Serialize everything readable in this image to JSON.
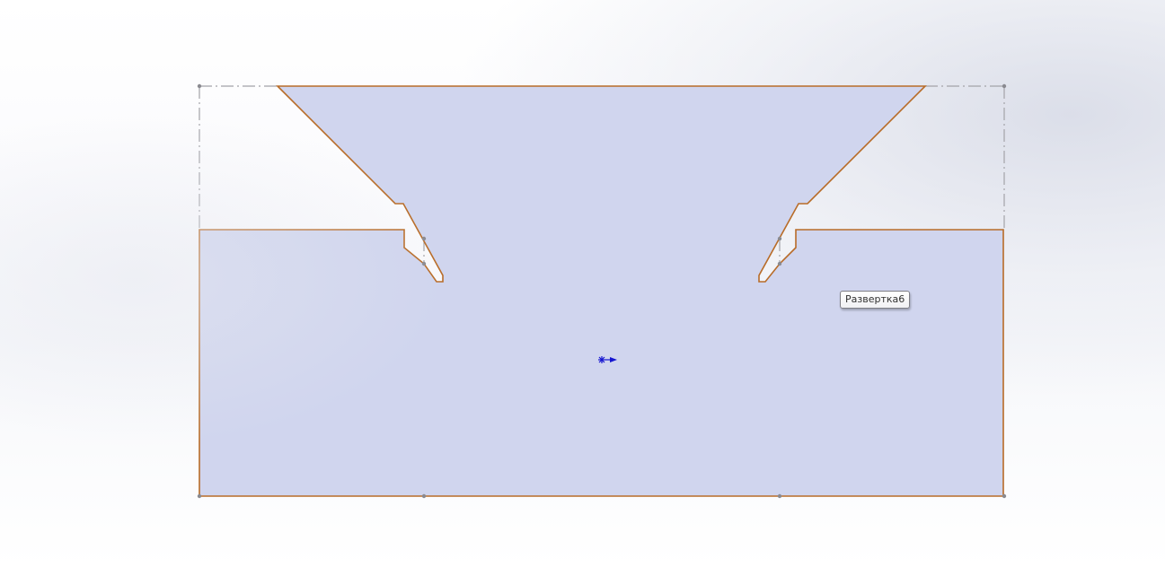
{
  "viewport": {
    "part_tooltip": "Развертка6"
  },
  "colors": {
    "face_fill": "#d0d5ee",
    "face_edge": "#b86c28",
    "bend_line": "#a3a3a8",
    "origin": "#1515d0"
  },
  "icons": {
    "origin": "origin-icon"
  }
}
